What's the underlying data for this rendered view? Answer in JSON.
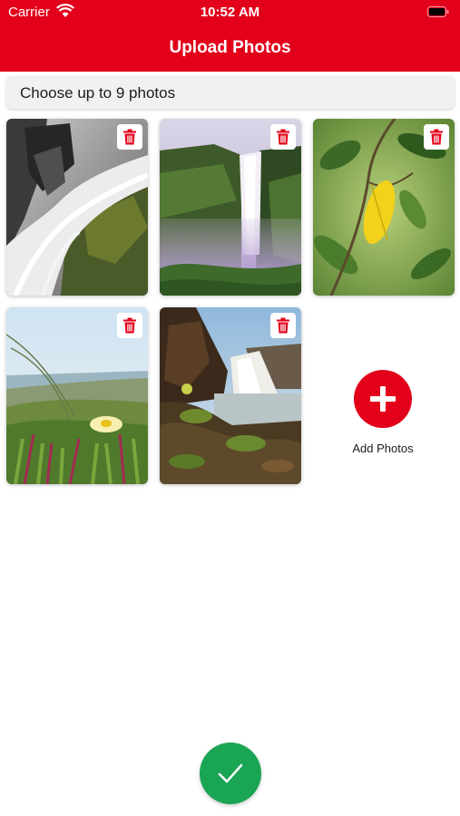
{
  "status_bar": {
    "carrier": "Carrier",
    "time": "10:52 AM"
  },
  "header": {
    "title": "Upload Photos"
  },
  "hint": {
    "text": "Choose up to 9 photos"
  },
  "photos": [
    {
      "subject": "waterfall-black-white"
    },
    {
      "subject": "misty-waterfall-cliff"
    },
    {
      "subject": "yellow-leaf-branch"
    },
    {
      "subject": "ice-plant-flower-coast"
    },
    {
      "subject": "coastal-waterfall-rocks"
    }
  ],
  "add_photos": {
    "label": "Add Photos",
    "icon": "plus-icon"
  },
  "confirm": {
    "icon": "checkmark-icon"
  },
  "colors": {
    "accent": "#e2001a",
    "confirm": "#1aa554",
    "hint_background": "#f1f1f1"
  }
}
